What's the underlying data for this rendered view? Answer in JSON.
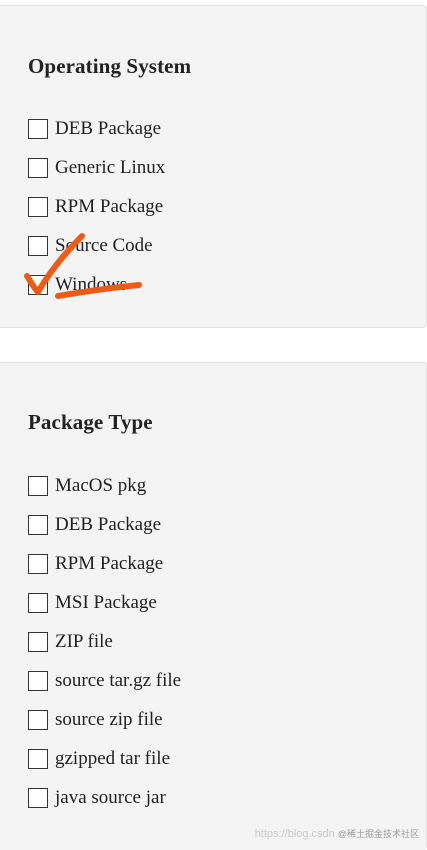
{
  "colors": {
    "panel_bg": "#f4f4f4",
    "annotation": "#f05a14"
  },
  "operating_system": {
    "title": "Operating System",
    "options": [
      {
        "label": "DEB Package",
        "checked": false
      },
      {
        "label": "Generic Linux",
        "checked": false
      },
      {
        "label": "RPM Package",
        "checked": false
      },
      {
        "label": "Source Code",
        "checked": false
      },
      {
        "label": "Windows",
        "checked": false
      }
    ]
  },
  "package_type": {
    "title": "Package Type",
    "options": [
      {
        "label": "MacOS pkg",
        "checked": false
      },
      {
        "label": "DEB Package",
        "checked": false
      },
      {
        "label": "RPM Package",
        "checked": false
      },
      {
        "label": "MSI Package",
        "checked": false
      },
      {
        "label": "ZIP file",
        "checked": false
      },
      {
        "label": "source tar.gz file",
        "checked": false
      },
      {
        "label": "source zip file",
        "checked": false
      },
      {
        "label": "gzipped tar file",
        "checked": false
      },
      {
        "label": "java source jar",
        "checked": false
      }
    ]
  },
  "watermark": {
    "url_text": "https://blog.csdn",
    "handle_text": "@稀土掘金技术社区"
  }
}
